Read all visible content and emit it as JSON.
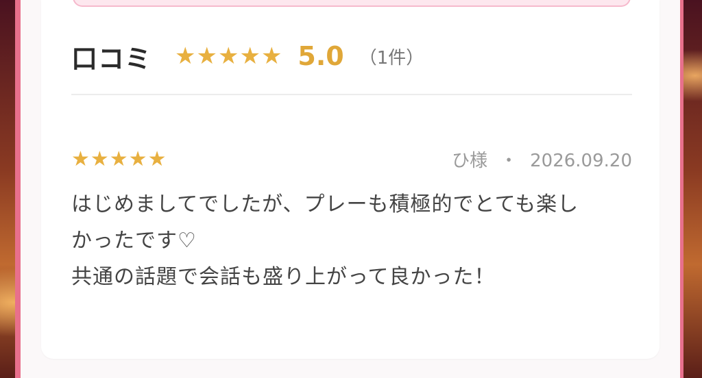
{
  "reviews": {
    "title": "口コミ",
    "stars": "★★★★★",
    "average_rating": "5.0",
    "count_text": "（1件）"
  },
  "review_items": [
    {
      "stars": "★★★★★",
      "reviewer": "ひ様",
      "separator": "・",
      "date": "2026.09.20",
      "body_lines": [
        "はじめましてでしたが、プレーも積極的でとても楽し",
        "かったです♡",
        "共通の話題で会話も盛り上がって良かった！"
      ]
    }
  ],
  "colors": {
    "accent_gold": "#e0a738",
    "frame_pink": "#e8708c",
    "title_text": "#2b2b2b",
    "body_text": "#444444"
  }
}
